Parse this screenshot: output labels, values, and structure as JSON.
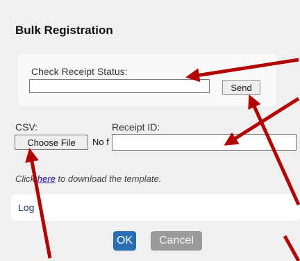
{
  "dialog": {
    "title": "Bulk Registration"
  },
  "receipt_status": {
    "label": "Check Receipt Status:",
    "value": "",
    "send_label": "Send"
  },
  "csv": {
    "label": "CSV:",
    "choose_file_label": "Choose File",
    "file_status": "No f"
  },
  "receipt_id": {
    "label": "Receipt ID:",
    "value": ""
  },
  "template_note": {
    "prefix": "Click ",
    "link_text": "here",
    "suffix": " to download the template."
  },
  "log": {
    "label": "Log"
  },
  "footer": {
    "ok_label": "OK",
    "cancel_label": "Cancel"
  },
  "annotations": {
    "arrow_color": "#b30000",
    "arrow_count": 5
  },
  "colors": {
    "ok_button": "#2a6eb5",
    "cancel_button": "#9a9a9a",
    "link": "#1a0dab"
  }
}
